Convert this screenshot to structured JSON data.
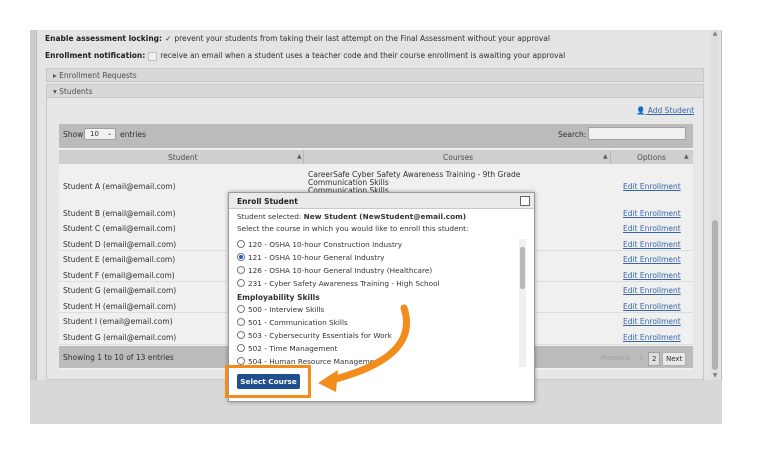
{
  "settings": {
    "locking_label": "Enable assessment locking:",
    "locking_text": "prevent your students from taking their last attempt on the Final Assessment without your approval",
    "notification_label": "Enrollment notification:",
    "notification_text": "receive an email when a student uses a teacher code and their course enrollment is awaiting your approval"
  },
  "accordion": {
    "enrollment_requests": "Enrollment Requests",
    "students": "Students"
  },
  "add_student": "Add Student",
  "table": {
    "show_label": "Show",
    "entries_value": "10",
    "entries_label": "entries",
    "search_label": "Search:",
    "columns": [
      "Student",
      "Courses",
      "Options"
    ],
    "rows": [
      {
        "name": "Student A (email@email.com)",
        "courses": [
          "CareerSafe Cyber Safety Awareness Training - 9th Grade",
          "Communication Skills",
          "Communication Skills"
        ],
        "option": "Edit Enrollment"
      },
      {
        "name": "Student B (email@email.com)",
        "courses": [],
        "option": "Edit Enrollment"
      },
      {
        "name": "Student C (email@email.com)",
        "courses": [],
        "option": "Edit Enrollment"
      },
      {
        "name": "Student D (email@email.com)",
        "courses": [],
        "option": "Edit Enrollment"
      },
      {
        "name": "Student E (email@email.com)",
        "courses": [],
        "option": "Edit Enrollment"
      },
      {
        "name": "Student F (email@email.com)",
        "courses": [],
        "option": "Edit Enrollment"
      },
      {
        "name": "Student G (email@email.com)",
        "courses": [],
        "option": "Edit Enrollment"
      },
      {
        "name": "Student H (email@email.com)",
        "courses": [],
        "option": "Edit Enrollment"
      },
      {
        "name": "Student I (email@email.com)",
        "courses": [],
        "option": "Edit Enrollment"
      },
      {
        "name": "Student G (email@email.com)",
        "courses": [],
        "option": "Edit Enrollment"
      }
    ],
    "footer_text": "Showing 1 to 10 of 13 entries",
    "pager": {
      "previous": "Previous",
      "page1": "1",
      "page2": "2",
      "next": "Next"
    }
  },
  "dialog": {
    "title": "Enroll Student",
    "selected_label": "Student selected:",
    "selected_value": "New Student (NewStudent@email.com)",
    "instruction": "Select the course in which you would like to enroll this student:",
    "options_group1": [
      {
        "label": "120 - OSHA 10-hour Construction Industry",
        "selected": false
      },
      {
        "label": "121 - OSHA 10-hour General Industry",
        "selected": true
      },
      {
        "label": "126 - OSHA 10-hour General Industry (Healthcare)",
        "selected": false
      },
      {
        "label": "231 - Cyber Safety Awareness Training - High School",
        "selected": false
      }
    ],
    "group2_title": "Employability Skills",
    "options_group2": [
      {
        "label": "500 - Interview Skills",
        "selected": false
      },
      {
        "label": "501 - Communication Skills",
        "selected": false
      },
      {
        "label": "503 - Cybersecurity Essentials for Work",
        "selected": false
      },
      {
        "label": "502 - Time Management",
        "selected": false
      },
      {
        "label": "504 - Human Resource Management",
        "selected": false
      }
    ],
    "button_label": "Select Course"
  },
  "colors": {
    "accent_blue": "#1f4f8f",
    "link_blue": "#3b6db3",
    "highlight_orange": "#f28c1a"
  }
}
